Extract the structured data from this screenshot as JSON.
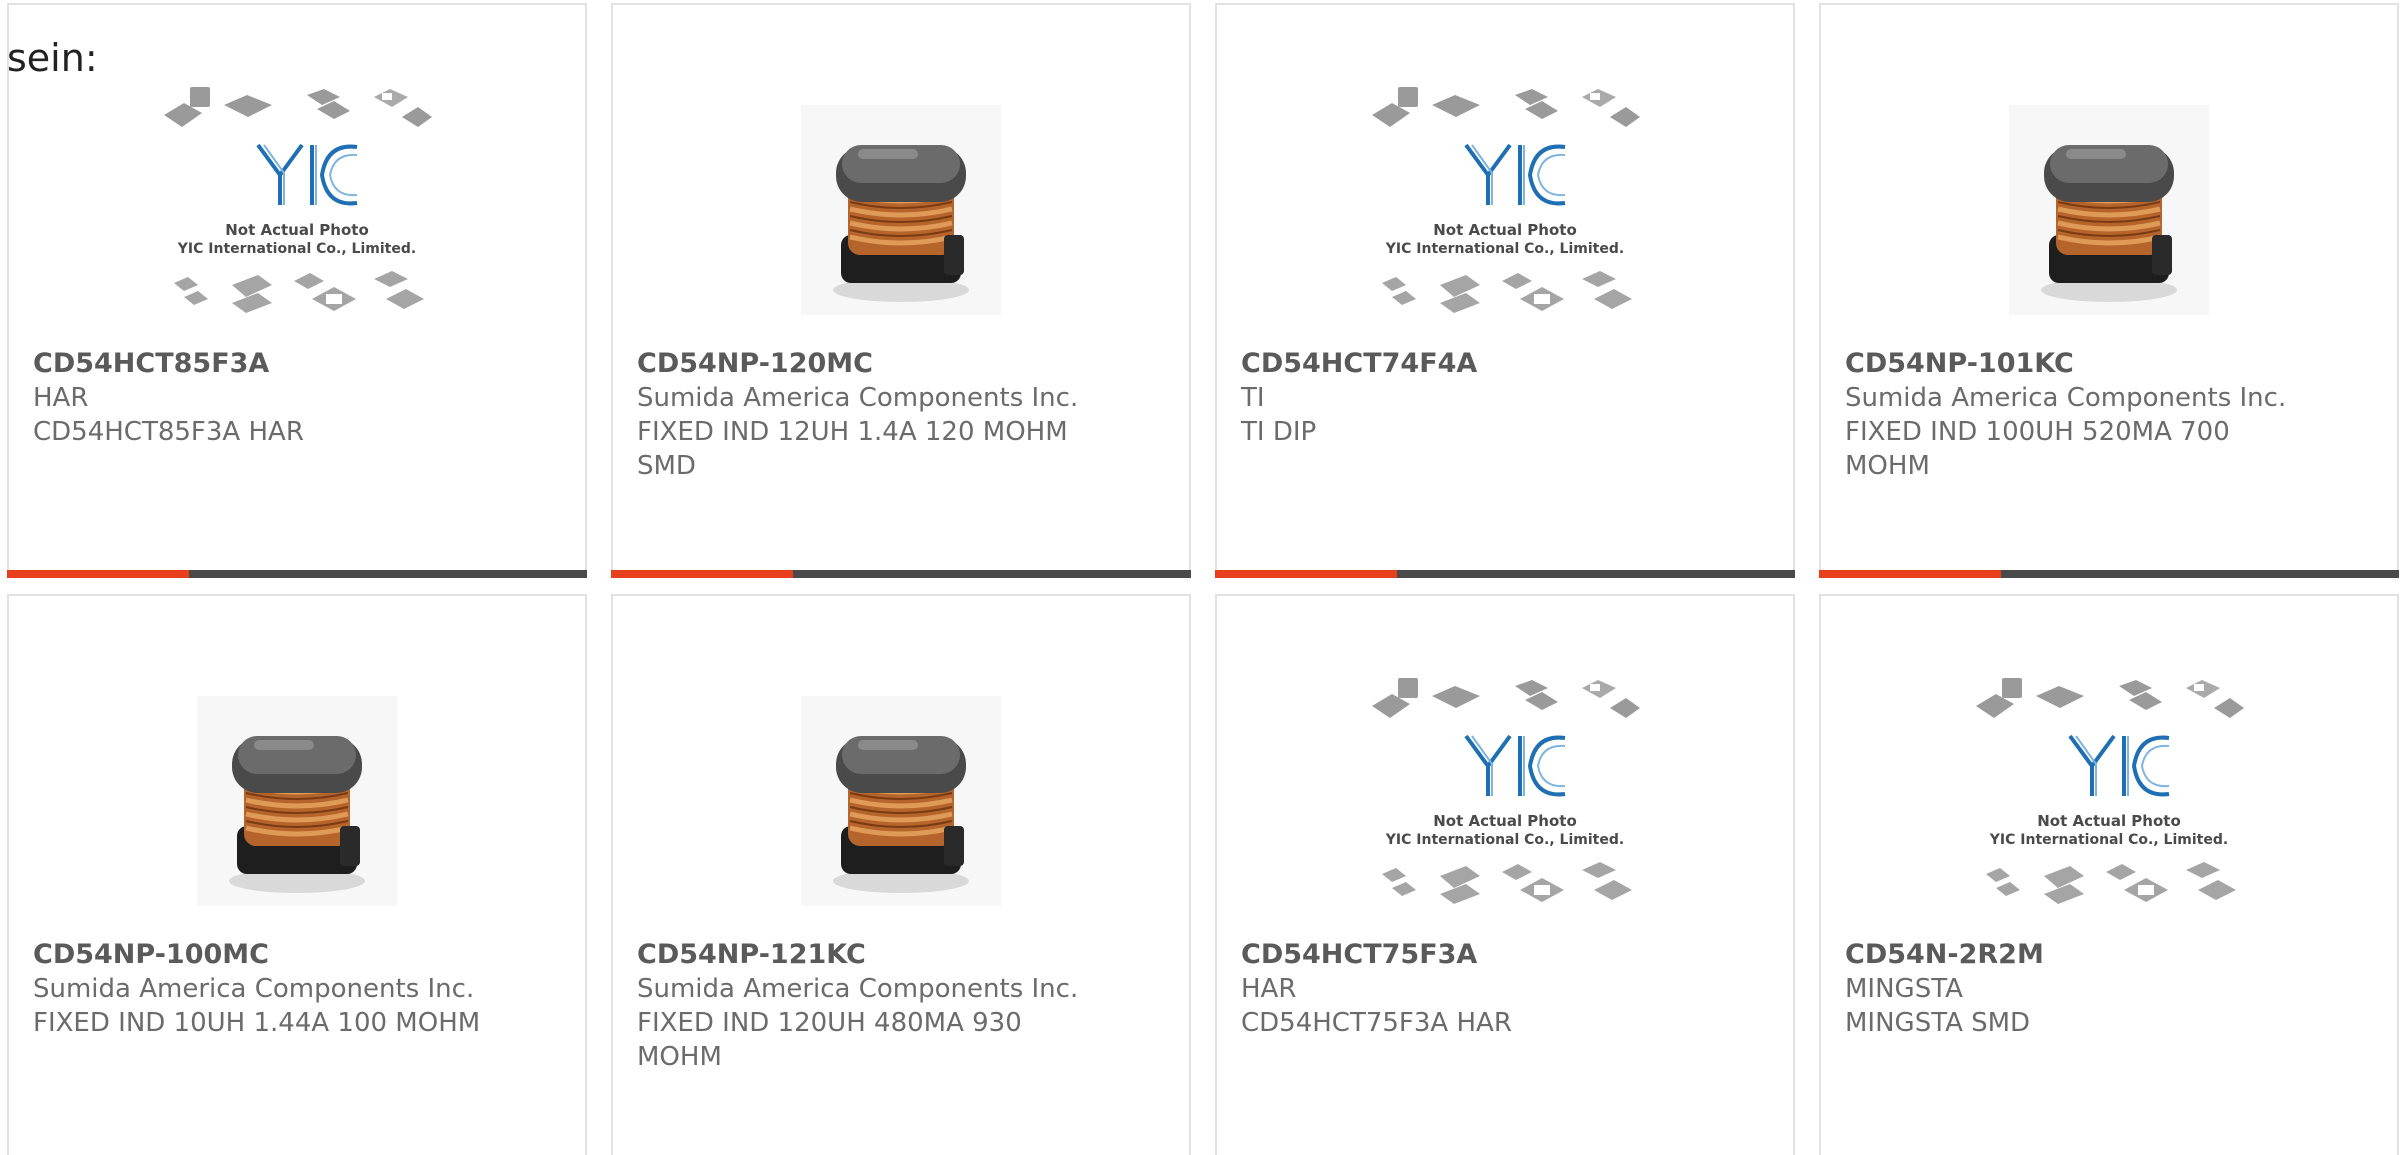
{
  "lead_text": "sein:",
  "colors": {
    "accent": "#e8401c",
    "bar": "#4a4a4a",
    "card_border": "#e2e2e2",
    "logo_blue": "#1f6fb5"
  },
  "placeholder_image": {
    "icon": "yic-not-actual-photo-icon",
    "line1": "Not Actual Photo",
    "line2": "YIC International Co., Limited."
  },
  "products": [
    {
      "pn": "CD54HCT85F3A",
      "mfr": "HAR",
      "desc": "CD54HCT85F3A HAR",
      "image": "placeholder"
    },
    {
      "pn": "CD54NP-120MC",
      "mfr": "Sumida America Components Inc.",
      "desc": "FIXED IND 12UH 1.4A 120 MOHM SMD",
      "image": "inductor"
    },
    {
      "pn": "CD54HCT74F4A",
      "mfr": "TI",
      "desc": "TI DIP",
      "image": "placeholder"
    },
    {
      "pn": "CD54NP-101KC",
      "mfr": "Sumida America Components Inc.",
      "desc": "FIXED IND 100UH 520MA 700 MOHM",
      "image": "inductor"
    },
    {
      "pn": "CD54NP-100MC",
      "mfr": "Sumida America Components Inc.",
      "desc": "FIXED IND 10UH 1.44A 100 MOHM",
      "image": "inductor"
    },
    {
      "pn": "CD54NP-121KC",
      "mfr": "Sumida America Components Inc.",
      "desc": "FIXED IND 120UH 480MA 930 MOHM",
      "image": "inductor"
    },
    {
      "pn": "CD54HCT75F3A",
      "mfr": "HAR",
      "desc": "CD54HCT75F3A HAR",
      "image": "placeholder"
    },
    {
      "pn": "CD54N-2R2M",
      "mfr": "MINGSTA",
      "desc": "MINGSTA SMD",
      "image": "placeholder"
    }
  ]
}
